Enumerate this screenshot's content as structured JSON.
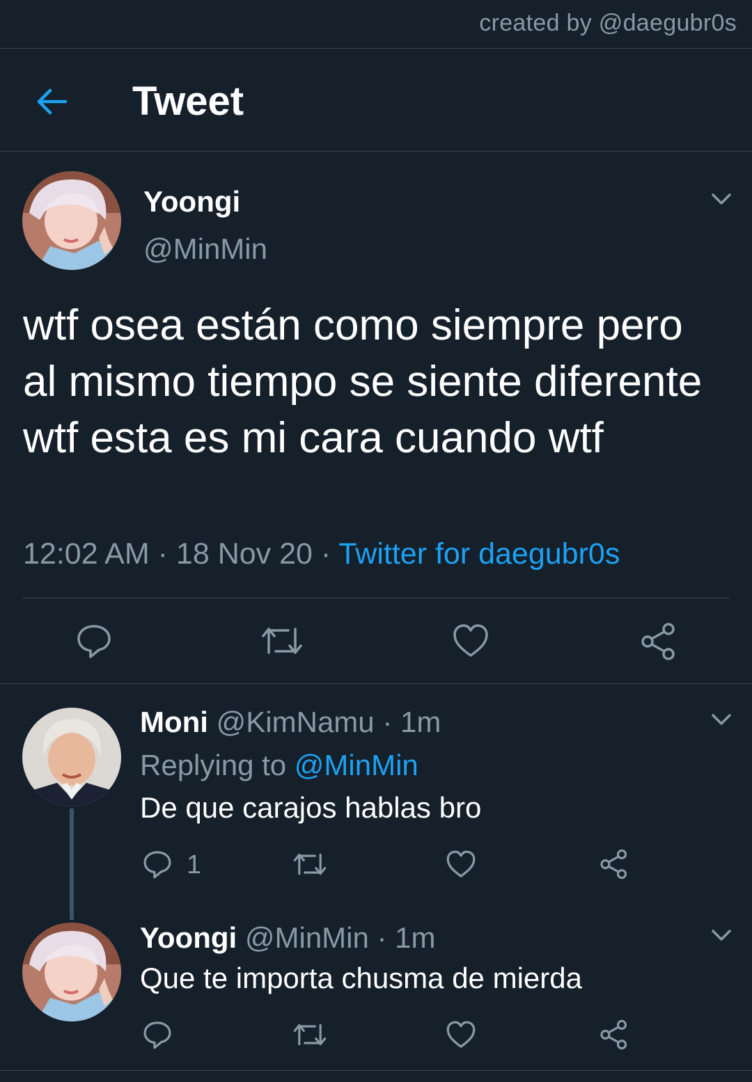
{
  "credit": "created by @daegubr0s",
  "header": {
    "title": "Tweet"
  },
  "tweet": {
    "name": "Yoongi",
    "handle": "@MinMin",
    "text": "wtf osea están como siempre pero al mismo tiempo se siente diferente wtf esta es mi cara cuando wtf",
    "time": "12:02 AM",
    "date": "18 Nov 20",
    "separator": "·",
    "source": "Twitter for daegubr0s"
  },
  "replies": [
    {
      "name": "Moni",
      "handle": "@KimNamu",
      "age": "· 1m",
      "replying_prefix": "Replying to",
      "replying_to": "@MinMin",
      "text": "De que carajos hablas bro",
      "reply_count": "1"
    },
    {
      "name": "Yoongi",
      "handle": "@MinMin",
      "age": "· 1m",
      "text": "Que te importa chusma de mierda"
    }
  ],
  "colors": {
    "background": "#15202b",
    "accent": "#1da1f2",
    "muted": "#8899a6",
    "divider": "#38444d"
  }
}
